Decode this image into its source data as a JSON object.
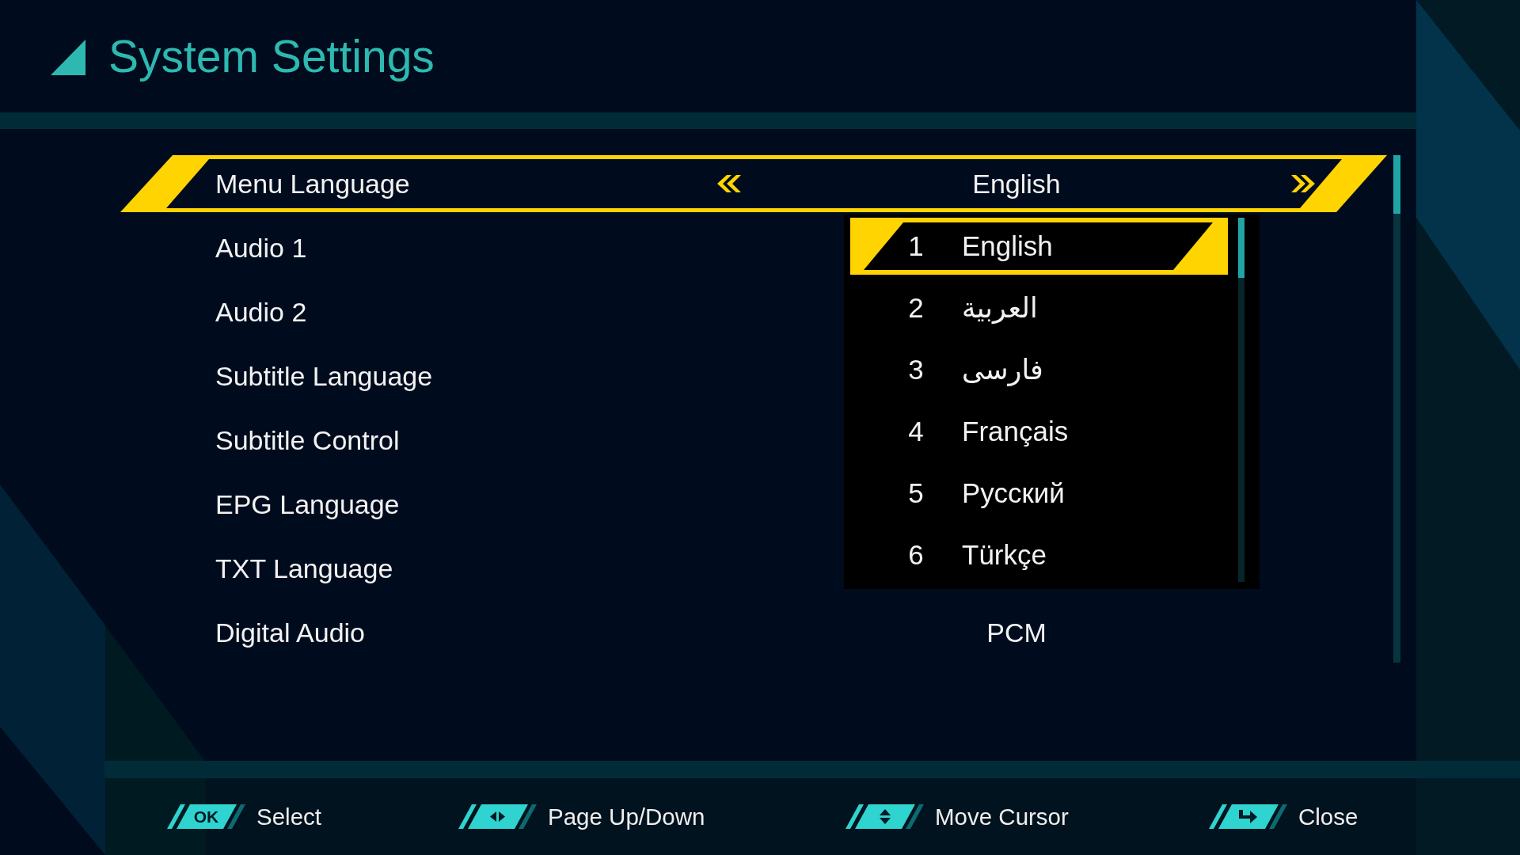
{
  "header": {
    "title": "System Settings"
  },
  "settings": [
    {
      "label": "Menu Language",
      "value": "English",
      "selected": true
    },
    {
      "label": "Audio 1",
      "selected": false
    },
    {
      "label": "Audio 2",
      "selected": false
    },
    {
      "label": "Subtitle Language",
      "selected": false
    },
    {
      "label": "Subtitle Control",
      "selected": false
    },
    {
      "label": "EPG Language",
      "selected": false
    },
    {
      "label": "TXT Language",
      "selected": false
    },
    {
      "label": "Digital Audio",
      "value": "PCM",
      "selected": false
    }
  ],
  "dropdown": {
    "items": [
      {
        "number": "1",
        "label": "English",
        "selected": true
      },
      {
        "number": "2",
        "label": "العربية",
        "selected": false
      },
      {
        "number": "3",
        "label": "فارسی",
        "selected": false
      },
      {
        "number": "4",
        "label": "Français",
        "selected": false
      },
      {
        "number": "5",
        "label": "Русский",
        "selected": false
      },
      {
        "number": "6",
        "label": "Türkçe",
        "selected": false
      }
    ]
  },
  "footer": {
    "hints": [
      {
        "kind": "key",
        "key": "OK",
        "label": "Select"
      },
      {
        "kind": "horizontal",
        "label": "Page Up/Down"
      },
      {
        "kind": "vertical",
        "label": "Move Cursor"
      },
      {
        "kind": "return",
        "label": "Close"
      }
    ]
  }
}
